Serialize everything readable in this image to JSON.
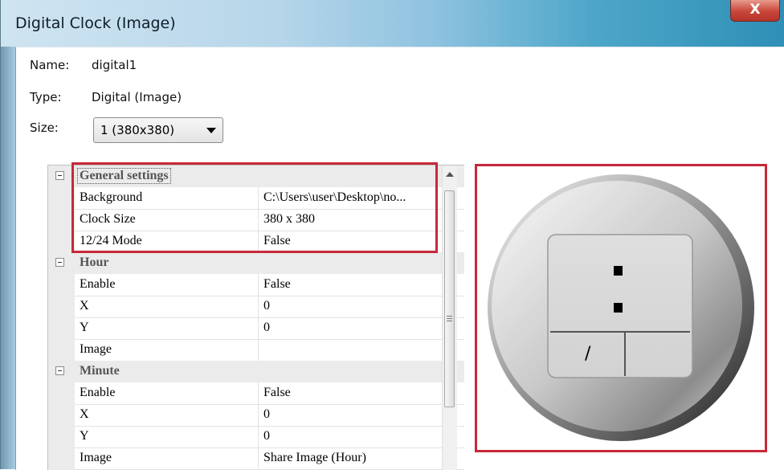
{
  "window": {
    "title": "Digital Clock (Image)",
    "close_label": "X"
  },
  "form": {
    "name_label": "Name:",
    "name_value": "digital1",
    "type_label": "Type:",
    "type_value": "Digital (Image)",
    "size_label": "Size:",
    "size_value": "1  (380x380)"
  },
  "grid": {
    "general": {
      "title": "General settings",
      "rows": [
        {
          "name": "Background",
          "value": "C:\\Users\\user\\Desktop\\no..."
        },
        {
          "name": "Clock Size",
          "value": "380 x 380"
        },
        {
          "name": "12/24 Mode",
          "value": "False"
        }
      ]
    },
    "hour": {
      "title": "Hour",
      "rows": [
        {
          "name": "Enable",
          "value": "False"
        },
        {
          "name": "X",
          "value": "0"
        },
        {
          "name": "Y",
          "value": "0"
        },
        {
          "name": "Image",
          "value": ""
        }
      ]
    },
    "minute": {
      "title": "Minute",
      "rows": [
        {
          "name": "Enable",
          "value": "False"
        },
        {
          "name": "X",
          "value": "0"
        },
        {
          "name": "Y",
          "value": "0"
        },
        {
          "name": "Image",
          "value": "Share Image (Hour)"
        }
      ]
    }
  },
  "preview": {
    "slash": "/"
  },
  "colors": {
    "highlight": "#c8283a"
  }
}
